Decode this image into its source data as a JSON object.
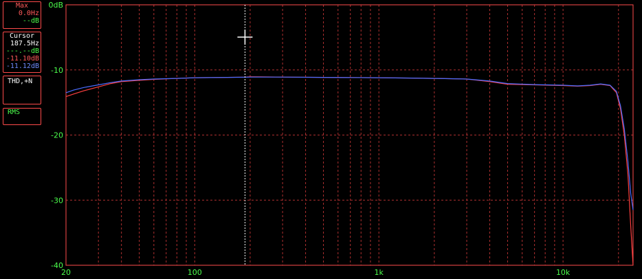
{
  "panels": {
    "max": {
      "title": "Max",
      "freq": "0.0Hz",
      "level": "--dB"
    },
    "cursor": {
      "title": "Cursor",
      "freq": "187.5Hz",
      "level_green": "---.--dB",
      "level_red": "-11.10dB",
      "level_blue": "-11.12dB"
    },
    "thd": {
      "title": "THD,+N"
    },
    "rms": {
      "title": "RMS"
    }
  },
  "colors": {
    "grid": "#b03030",
    "frame": "#ff4b4b",
    "label": "#4cff4c",
    "series_red": "#ff4040",
    "series_blue": "#4a6cff",
    "cursor": "#ffffff"
  },
  "chart_data": {
    "type": "line",
    "x_scale": "log",
    "xlim": [
      20,
      24000
    ],
    "ylim": [
      -40,
      0
    ],
    "x_ticks": [
      {
        "value": 20,
        "label": "20"
      },
      {
        "value": 100,
        "label": "100"
      },
      {
        "value": 1000,
        "label": "1k"
      },
      {
        "value": 10000,
        "label": "10k"
      }
    ],
    "y_ticks": [
      {
        "value": 0,
        "label": "0dB"
      },
      {
        "value": -10,
        "label": "-10"
      },
      {
        "value": -20,
        "label": "-20"
      },
      {
        "value": -30,
        "label": "-30"
      },
      {
        "value": -40,
        "label": "-40"
      }
    ],
    "grid": true,
    "cursor": {
      "x": 187.5
    },
    "series": [
      {
        "color": "#ff4040",
        "points": [
          [
            20,
            -14.1
          ],
          [
            22,
            -13.7
          ],
          [
            25,
            -13.2
          ],
          [
            30,
            -12.6
          ],
          [
            35,
            -12.1
          ],
          [
            40,
            -11.8
          ],
          [
            50,
            -11.6
          ],
          [
            60,
            -11.45
          ],
          [
            80,
            -11.3
          ],
          [
            100,
            -11.2
          ],
          [
            150,
            -11.15
          ],
          [
            187.5,
            -11.1
          ],
          [
            200,
            -11.05
          ],
          [
            300,
            -11.1
          ],
          [
            500,
            -11.15
          ],
          [
            1000,
            -11.2
          ],
          [
            1500,
            -11.25
          ],
          [
            2000,
            -11.3
          ],
          [
            3000,
            -11.4
          ],
          [
            4000,
            -11.8
          ],
          [
            5000,
            -12.2
          ],
          [
            7000,
            -12.3
          ],
          [
            10000,
            -12.4
          ],
          [
            12000,
            -12.5
          ],
          [
            14000,
            -12.4
          ],
          [
            16000,
            -12.2
          ],
          [
            18000,
            -12.4
          ],
          [
            19500,
            -13.5
          ],
          [
            20500,
            -16
          ],
          [
            21500,
            -20
          ],
          [
            22500,
            -26
          ],
          [
            23300,
            -34
          ],
          [
            24000,
            -40
          ]
        ]
      },
      {
        "color": "#4a6cff",
        "points": [
          [
            20,
            -13.5
          ],
          [
            22,
            -13.1
          ],
          [
            25,
            -12.7
          ],
          [
            30,
            -12.3
          ],
          [
            35,
            -11.95
          ],
          [
            40,
            -11.7
          ],
          [
            50,
            -11.5
          ],
          [
            60,
            -11.4
          ],
          [
            80,
            -11.3
          ],
          [
            100,
            -11.2
          ],
          [
            150,
            -11.15
          ],
          [
            187.5,
            -11.12
          ],
          [
            200,
            -11.1
          ],
          [
            300,
            -11.1
          ],
          [
            500,
            -11.15
          ],
          [
            1000,
            -11.2
          ],
          [
            1500,
            -11.25
          ],
          [
            2000,
            -11.3
          ],
          [
            3000,
            -11.4
          ],
          [
            4000,
            -11.7
          ],
          [
            5000,
            -12.1
          ],
          [
            7000,
            -12.25
          ],
          [
            10000,
            -12.35
          ],
          [
            12000,
            -12.45
          ],
          [
            14000,
            -12.35
          ],
          [
            16000,
            -12.15
          ],
          [
            18000,
            -12.35
          ],
          [
            19500,
            -13.3
          ],
          [
            20500,
            -15.5
          ],
          [
            21500,
            -19
          ],
          [
            22500,
            -24
          ],
          [
            23300,
            -29
          ],
          [
            24000,
            -31.5
          ]
        ]
      }
    ]
  }
}
